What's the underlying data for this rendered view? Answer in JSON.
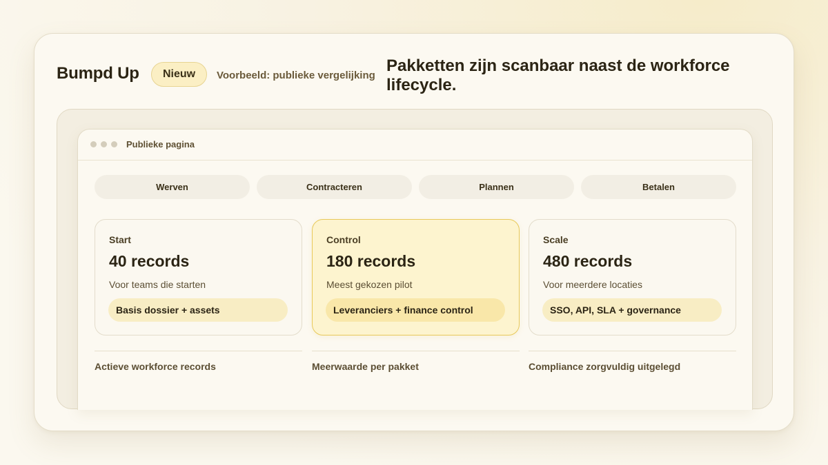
{
  "header": {
    "brand": "Bumpd Up",
    "badge": "Nieuw",
    "subtitle": "Voorbeeld: publieke vergelijking",
    "headline": "Pakketten zijn scanbaar naast de workforce lifecycle."
  },
  "browser": {
    "title": "Publieke pagina"
  },
  "tabs": [
    {
      "label": "Werven"
    },
    {
      "label": "Contracteren"
    },
    {
      "label": "Plannen"
    },
    {
      "label": "Betalen"
    }
  ],
  "plans": [
    {
      "name": "Start",
      "price": "40 records",
      "description": "Voor teams die starten",
      "feature": "Basis dossier + assets"
    },
    {
      "name": "Control",
      "price": "180 records",
      "description": "Meest gekozen pilot",
      "feature": "Leveranciers + finance control"
    },
    {
      "name": "Scale",
      "price": "480 records",
      "description": "Voor meerdere locaties",
      "feature": "SSO, API, SLA + governance"
    }
  ],
  "footer": [
    {
      "label": "Actieve workforce records"
    },
    {
      "label": "Meerwaarde per pakket"
    },
    {
      "label": "Compliance zorgvuldig uitgelegd"
    }
  ],
  "colors": {
    "accent": "#fbefc4",
    "highlight_border": "#e8c95a",
    "text": "#2b2414"
  }
}
